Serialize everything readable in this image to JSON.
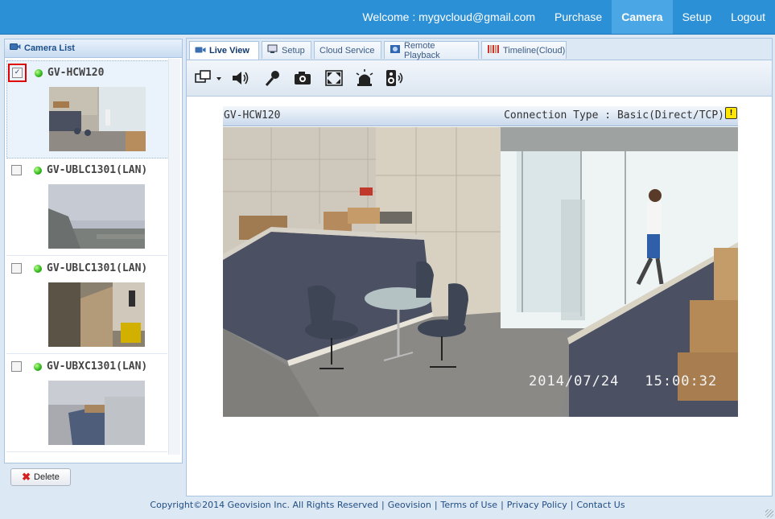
{
  "topbar": {
    "welcome": "Welcome : mygvcloud@gmail.com",
    "purchase": "Purchase",
    "camera": "Camera",
    "setup": "Setup",
    "logout": "Logout"
  },
  "camera_list": {
    "title": "Camera List",
    "items": [
      {
        "name": "GV-HCW120",
        "checked": true,
        "status": "online"
      },
      {
        "name": "GV-UBLC1301(LAN)",
        "checked": false,
        "status": "online"
      },
      {
        "name": "GV-UBLC1301(LAN)",
        "checked": false,
        "status": "online"
      },
      {
        "name": "GV-UBXC1301(LAN)",
        "checked": false,
        "status": "online"
      }
    ],
    "delete_label": "Delete"
  },
  "tabs": {
    "live_view": "Live View",
    "setup": "Setup",
    "cloud_service": "Cloud Service",
    "remote_playback": "Remote Playback",
    "timeline": "Timeline(Cloud)"
  },
  "toolbar": {
    "icons": [
      "layout-icon",
      "speaker-icon",
      "microphone-icon",
      "snapshot-icon",
      "fullscreen-icon",
      "alarm-light-icon",
      "audio-output-icon"
    ]
  },
  "video": {
    "camera_name": "GV-HCW120",
    "connection_type": "Connection Type : Basic(Direct/TCP)",
    "date": "2014/07/24",
    "time": "15:00:32"
  },
  "footer": {
    "copyright": "Copyright©2014 Geovision Inc. All Rights Reserved",
    "geovision": "Geovision",
    "terms": "Terms of Use",
    "privacy": "Privacy Policy",
    "contact": "Contact Us"
  }
}
